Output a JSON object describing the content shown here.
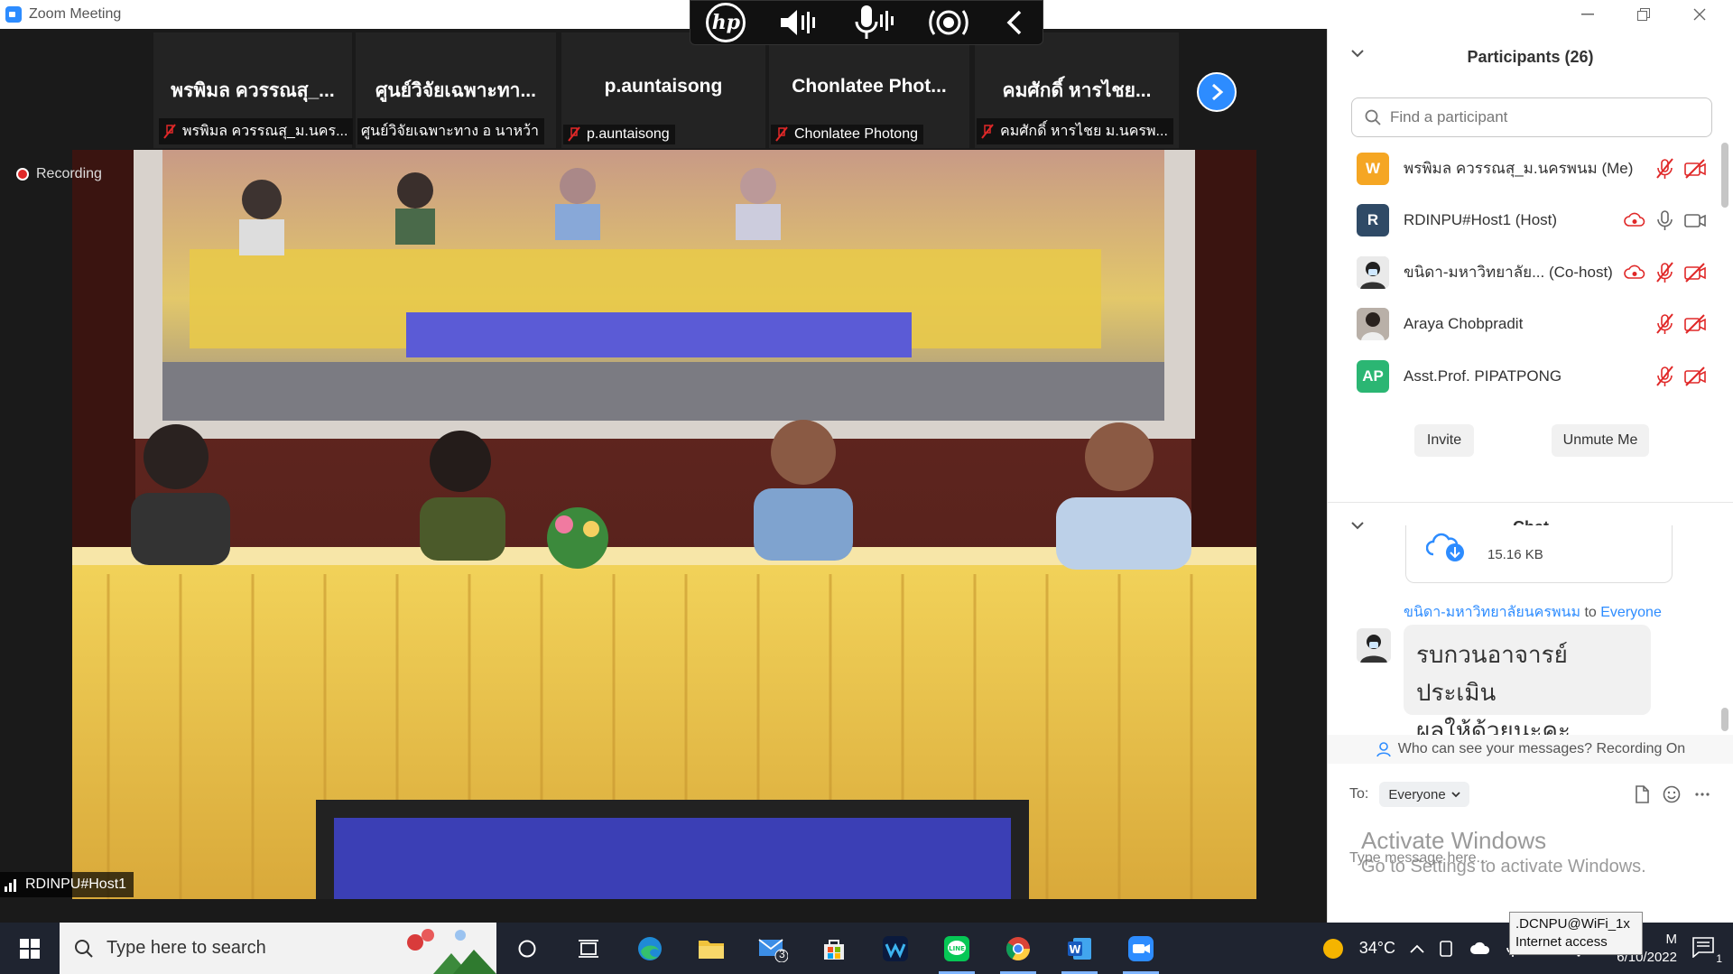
{
  "window": {
    "title": "Zoom Meeting",
    "controls": [
      "minimize",
      "restore",
      "close"
    ]
  },
  "hp_bar": {
    "logo": "hp",
    "icons": [
      "speaker-icon",
      "microphone-icon",
      "broadcast-icon",
      "chevron-left-icon"
    ]
  },
  "video_strip": {
    "tiles": [
      {
        "display_name": "พรพิมล ควรรณสุ_...",
        "label": "พรพิมล ควรรณสุ_ม.นคร...",
        "muted": true
      },
      {
        "display_name": "ศูนย์วิจัยเฉพาะทา...",
        "label": "ศูนย์วิจัยเฉพาะทาง อ นาหว้า",
        "muted": false
      },
      {
        "display_name": "p.auntaisong",
        "label": "p.auntaisong",
        "muted": true
      },
      {
        "display_name": "Chonlatee  Phot...",
        "label": "Chonlatee Photong",
        "muted": true
      },
      {
        "display_name": "คมศักดิ์  หารไชย...",
        "label": "คมศักดิ์  หารไชย ม.นครพ...",
        "muted": true
      }
    ]
  },
  "main_video": {
    "recording_label": "Recording",
    "speaker_name": "RDINPU#Host1"
  },
  "participants": {
    "header": "Participants (26)",
    "search_placeholder": "Find a participant",
    "list": [
      {
        "avatar_text": "W",
        "avatar_color": "#f5a623",
        "name": "พรพิมล ควรรณสุ_ม.นครพนม (Me)",
        "recording": false,
        "mic_muted": true,
        "video_off": true
      },
      {
        "avatar_text": "R",
        "avatar_color": "#2f4a66",
        "name": "RDINPU#Host1 (Host)",
        "recording": true,
        "mic_muted": false,
        "video_off": false
      },
      {
        "avatar_text": "",
        "avatar_color": "#d9d9d9",
        "name": "ขนิดา-มหาวิทยาลัย...  (Co-host)",
        "recording": true,
        "mic_muted": true,
        "video_off": true
      },
      {
        "avatar_text": "",
        "avatar_color": "#cccccc",
        "name": "Araya Chobpradit",
        "recording": false,
        "mic_muted": true,
        "video_off": true
      },
      {
        "avatar_text": "AP",
        "avatar_color": "#2bb673",
        "name": "Asst.Prof. PIPATPONG",
        "recording": false,
        "mic_muted": true,
        "video_off": true
      }
    ],
    "buttons": {
      "invite": "Invite",
      "unmute": "Unmute Me"
    }
  },
  "chat": {
    "header": "Chat",
    "file_size": "15.16 KB",
    "sender": "ขนิดา-มหาวิทยาลัยนครพนม",
    "to_word": "to",
    "recipient": "Everyone",
    "message_line1": "รบกวนอาจารย์ประเมิน",
    "message_line2": "ผลให้ด้วยนะคะ",
    "who_can_see": "Who can see your messages? Recording On",
    "to_label": "To:",
    "to_value": "Everyone",
    "input_placeholder": "Type message here..."
  },
  "watermark": {
    "line1": "Activate Windows",
    "line2": "Go to Settings to activate Windows."
  },
  "taskbar": {
    "search_placeholder": "Type here to search",
    "apps": [
      "cortana-icon",
      "task-view-icon",
      "edge-icon",
      "file-explorer-icon",
      "mail-icon",
      "store-icon",
      "webex-icon",
      "line-icon",
      "chrome-icon",
      "word-icon",
      "zoom-icon"
    ],
    "mail_badge": "3",
    "weather": "34°C",
    "time": "M",
    "date": "6/10/2022",
    "notification_count": "1",
    "tooltip_line1": ".DCNPU@WiFi_1x",
    "tooltip_line2": "Internet access",
    "colors": {
      "taskbar": "#1f2430",
      "accent": "#2d8cff"
    }
  }
}
